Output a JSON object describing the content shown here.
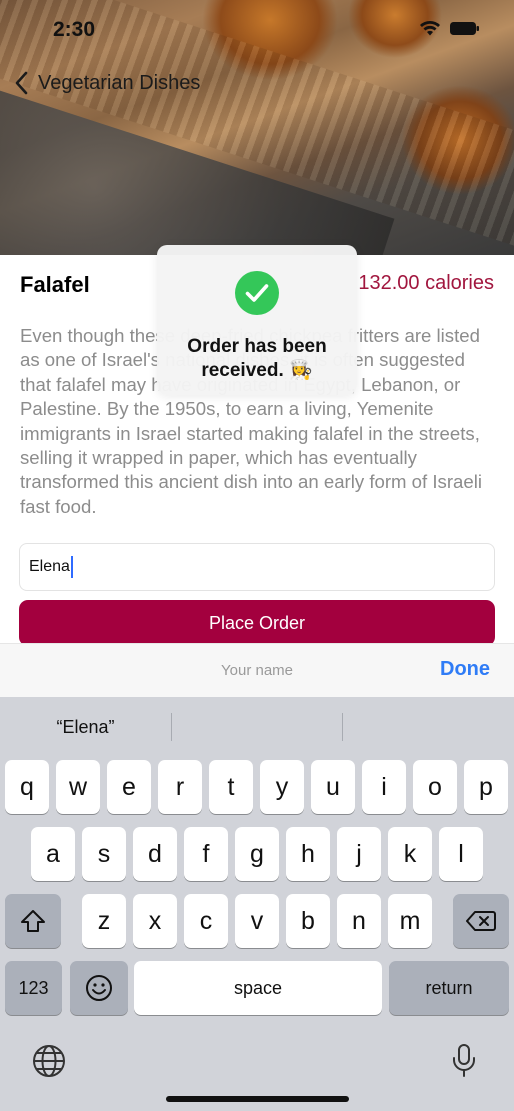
{
  "status_bar": {
    "time": "2:30"
  },
  "nav": {
    "back_label": "Vegetarian Dishes"
  },
  "dish": {
    "name": "Falafel",
    "calories": "132.00 calories",
    "description": "Even though these deep-fried chickpea fritters are listed as one of Israel's national dishes, it is often suggested that falafel may have originated in Egypt, Lebanon, or Palestine. By the 1950s, to earn a living, Yemenite immigrants in Israel started making falafel in the streets, selling it wrapped in paper, which has eventually transformed this ancient dish into an early form of Israeli fast food."
  },
  "order": {
    "name_value": "Elena",
    "button_label": "Place Order"
  },
  "toast": {
    "message": "Order has been received. 👩‍🍳"
  },
  "keyboard_accessory": {
    "title": "Your name",
    "done_label": "Done"
  },
  "keyboard": {
    "suggestion": "“Elena”",
    "row1": [
      "q",
      "w",
      "e",
      "r",
      "t",
      "y",
      "u",
      "i",
      "o",
      "p"
    ],
    "row2": [
      "a",
      "s",
      "d",
      "f",
      "g",
      "h",
      "j",
      "k",
      "l"
    ],
    "row3": [
      "z",
      "x",
      "c",
      "v",
      "b",
      "n",
      "m"
    ],
    "numbers_label": "123",
    "space_label": "space",
    "return_label": "return"
  },
  "colors": {
    "accent": "#a3003e",
    "done_blue": "#2f7cf6",
    "success_green": "#34c759"
  }
}
